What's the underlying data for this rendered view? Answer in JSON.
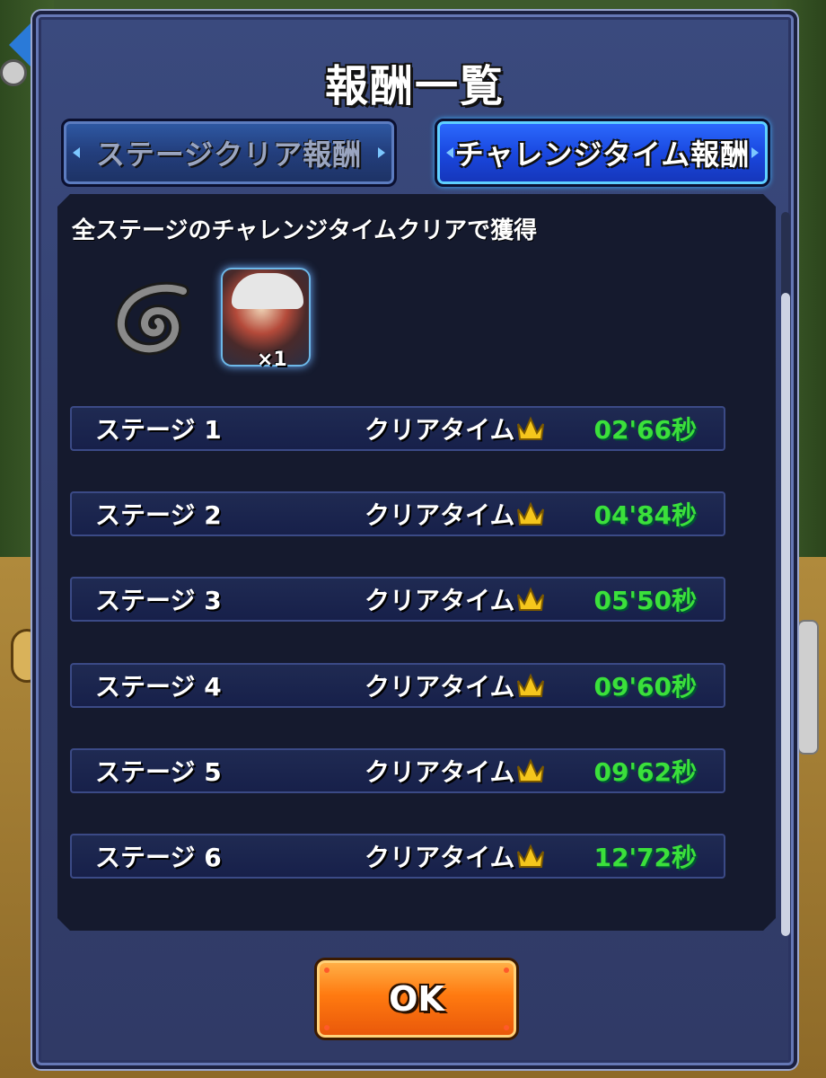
{
  "dialog": {
    "title": "報酬一覧"
  },
  "tabs": [
    {
      "label": "ステージクリア報酬",
      "active": false
    },
    {
      "label": "チャレンジタイム報酬",
      "active": true
    }
  ],
  "panel": {
    "description": "全ステージのチャレンジタイムクリアで獲得"
  },
  "rewards": [
    {
      "icon": "leaf-village-icon"
    },
    {
      "icon": "character-portrait-icon",
      "quantity": "×1"
    }
  ],
  "stages": [
    {
      "stage": "ステージ 1",
      "label": "クリアタイム",
      "time": "02'66秒"
    },
    {
      "stage": "ステージ 2",
      "label": "クリアタイム",
      "time": "04'84秒"
    },
    {
      "stage": "ステージ 3",
      "label": "クリアタイム",
      "time": "05'50秒"
    },
    {
      "stage": "ステージ 4",
      "label": "クリアタイム",
      "time": "09'60秒"
    },
    {
      "stage": "ステージ 5",
      "label": "クリアタイム",
      "time": "09'62秒"
    },
    {
      "stage": "ステージ 6",
      "label": "クリアタイム",
      "time": "12'72秒"
    }
  ],
  "buttons": {
    "ok": "OK"
  },
  "colors": {
    "time_green": "#3be03b",
    "active_tab": "#1a48e0",
    "ok_orange": "#ff7a10",
    "crown_gold": "#f5c61c"
  }
}
